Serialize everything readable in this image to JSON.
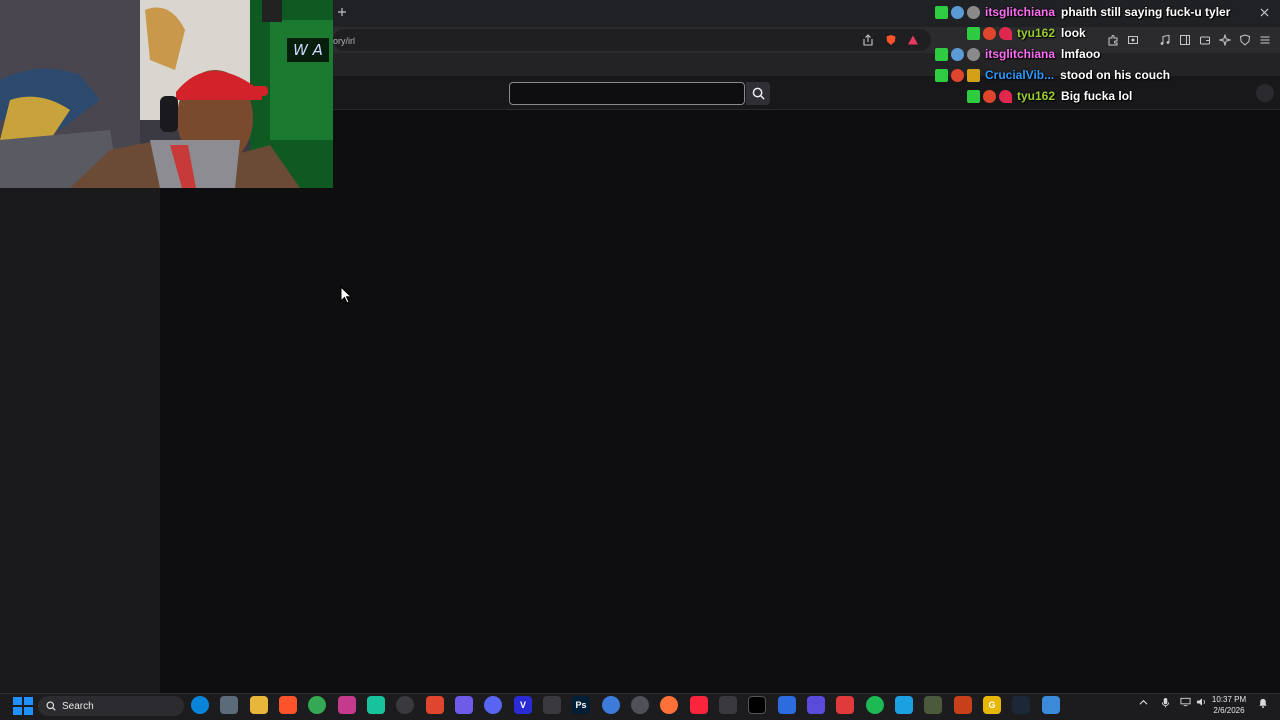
{
  "browser": {
    "url_fragment": "ory/irl",
    "new_tab_icon": "plus-icon",
    "close_icon": "close-icon"
  },
  "search": {
    "placeholder": "",
    "value": ""
  },
  "webcam": {
    "watermark": "W A"
  },
  "chat": {
    "messages": [
      {
        "user": "itsglitchiana",
        "user_color": "#ff6ef5",
        "text": "phaith still saying fuck-u tyler"
      },
      {
        "user": "tyu162",
        "user_color": "#9acd32",
        "text": "look"
      },
      {
        "user": "itsglitchiana",
        "user_color": "#ff6ef5",
        "text": "lmfaoo"
      },
      {
        "user": "CrucialVib...",
        "user_color": "#2a9bff",
        "text": "stood on his couch"
      },
      {
        "user": "tyu162",
        "user_color": "#9acd32",
        "text": "Big fucka lol"
      }
    ]
  },
  "taskbar": {
    "search_label": "Search",
    "time": "10:37 PM",
    "date": "2/6/2026"
  },
  "colors": {
    "page_bg": "#0e0e10",
    "sidebar_bg": "#1a1a1d",
    "windows_blue": "#1e90ff"
  }
}
